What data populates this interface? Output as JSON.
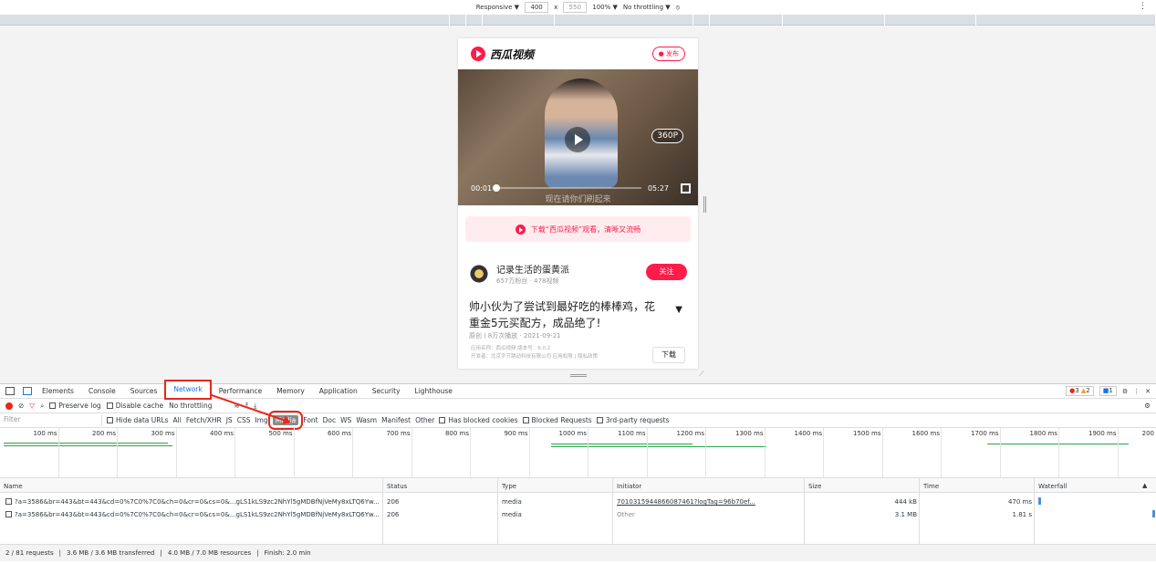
{
  "device_toolbar": {
    "device": "Responsive ▼",
    "width": "400",
    "x": "x",
    "height": "550",
    "zoom": "100% ▼",
    "throttle": "No throttling ▼",
    "more": "⋮"
  },
  "phone": {
    "logo_text": "西瓜视频",
    "publish": "发布",
    "resolution": "360P",
    "time_current": "00:01",
    "time_total": "05:27",
    "subtitle": "现在请你们刷起来",
    "download_banner": "下载“西瓜视频”观看，清晰又流畅",
    "author_name": "记录生活的蛋黄派",
    "author_meta": "657万粉丝 · 478视频",
    "follow": "关注",
    "video_title": "帅小伙为了尝试到最好吃的棒棒鸡，花重金5元买配方，成品绝了!",
    "caret": "▼",
    "pub_meta": "原创 | 8万次播放 · 2021-09-21",
    "app_info_1": "应用名称：西瓜视频   版本号：6.0.2",
    "app_info_2": "开发者：北京字节跳动科技有限公司 应用权限 | 隐私政策",
    "download_btn": "下载"
  },
  "devtools": {
    "tabs": [
      "Elements",
      "Console",
      "Sources",
      "Network",
      "Performance",
      "Memory",
      "Application",
      "Security",
      "Lighthouse"
    ],
    "errors": "3",
    "warnings": "2",
    "messages": "1",
    "close": "✕",
    "toolbar": {
      "preserve_log": "Preserve log",
      "disable_cache": "Disable cache",
      "throttling": "No throttling"
    },
    "filter": {
      "placeholder": "Filter",
      "hide_data": "Hide data URLs",
      "types": [
        "All",
        "Fetch/XHR",
        "JS",
        "CSS",
        "Img",
        "Media",
        "Font",
        "Doc",
        "WS",
        "Wasm",
        "Manifest",
        "Other"
      ],
      "blocked_cookies": "Has blocked cookies",
      "blocked_requests": "Blocked Requests",
      "third_party": "3rd-party requests"
    },
    "timeline_labels": [
      "100 ms",
      "200 ms",
      "300 ms",
      "400 ms",
      "500 ms",
      "600 ms",
      "700 ms",
      "800 ms",
      "900 ms",
      "1000 ms",
      "1100 ms",
      "1200 ms",
      "1300 ms",
      "1400 ms",
      "1500 ms",
      "1600 ms",
      "1700 ms",
      "1800 ms",
      "1900 ms",
      "200"
    ],
    "columns": [
      "Name",
      "Status",
      "Type",
      "Initiator",
      "Size",
      "Time",
      "Waterfall"
    ],
    "rows": [
      {
        "name": "?a=3586&br=443&bt=443&cd=0%7C0%7C0&ch=0&cr=0&cs=0&...gLS1kLS9zc2NhYl5gMDBfNjVeMy8xLTQ6Yw...",
        "status": "206",
        "type": "media",
        "initiator": "7010315944866087461?logTag=96b70ef...",
        "size": "444 kB",
        "time": "470 ms"
      },
      {
        "name": "?a=3586&br=443&bt=443&cd=0%7C0%7C0&ch=0&cr=0&cs=0&...gLS1kLS9zc2NhYl5gMDBfNjVeMy8xLTQ6Yw...",
        "status": "206",
        "type": "media",
        "initiator": "Other",
        "size": "3.1 MB",
        "time": "1.81 s"
      }
    ],
    "status_bar": {
      "requests": "2 / 81 requests",
      "transferred": "3.6 MB / 3.6 MB transferred",
      "resources": "4.0 MB / 7.0 MB resources",
      "finish": "Finish: 2.0 min"
    }
  },
  "colors": {
    "accent": "#1a73e8",
    "brand": "#ff1c4a",
    "highlight": "#e8271b"
  }
}
